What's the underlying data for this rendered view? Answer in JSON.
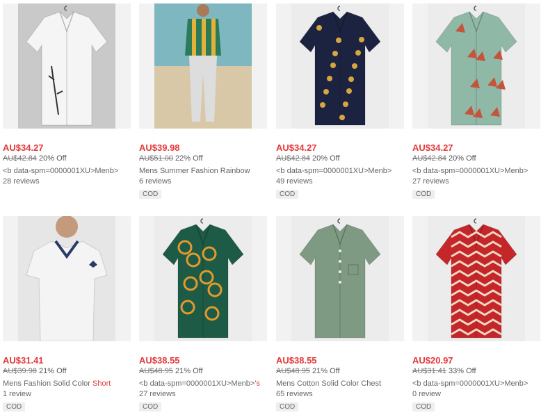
{
  "products": [
    {
      "price": "AU$34.27",
      "original_price": "AU$42.84",
      "discount": "20% Off",
      "title": "<b data-spm=0000001XU>Menb>",
      "title_highlight": "",
      "reviews": "28 reviews",
      "badge": ""
    },
    {
      "price": "AU$39.98",
      "original_price": "AU$51.00",
      "discount": "22% Off",
      "title": "Mens Summer Fashion Rainbow",
      "title_highlight": "",
      "reviews": "6 reviews",
      "badge": "COD"
    },
    {
      "price": "AU$34.27",
      "original_price": "AU$42.84",
      "discount": "20% Off",
      "title": "<b data-spm=0000001XU>Menb>",
      "title_highlight": "",
      "reviews": "49 reviews",
      "badge": "COD"
    },
    {
      "price": "AU$34.27",
      "original_price": "AU$42.84",
      "discount": "20% Off",
      "title": "<b data-spm=0000001XU>Menb>",
      "title_highlight": "",
      "reviews": "27 reviews",
      "badge": "COD"
    },
    {
      "price": "AU$31.41",
      "original_price": "AU$39.98",
      "discount": "21% Off",
      "title": "Mens Fashion Solid Color ",
      "title_highlight": "Short",
      "reviews": "1 review",
      "badge": "COD"
    },
    {
      "price": "AU$38.55",
      "original_price": "AU$48.95",
      "discount": "21% Off",
      "title": "<b data-spm=0000001XU>Menb>",
      "title_highlight": "'s",
      "reviews": "27 reviews",
      "badge": "COD"
    },
    {
      "price": "AU$38.55",
      "original_price": "AU$48.95",
      "discount": "21% Off",
      "title": "Mens Cotton Solid Color Chest",
      "title_highlight": "",
      "reviews": "65 reviews",
      "badge": "COD"
    },
    {
      "price": "AU$20.97",
      "original_price": "AU$31.41",
      "discount": "33% Off",
      "title": "<b data-spm=0000001XU>Menb>",
      "title_highlight": "",
      "reviews": "0 review",
      "badge": "COD"
    }
  ],
  "images": [
    {
      "name": "white-shirt-image",
      "bg": "#c9c9c9",
      "color": "#f5f5f5",
      "pattern": "bamboo"
    },
    {
      "name": "rainbow-stripe-shirt-model-image",
      "bg": "#d8cfc0",
      "color": "#dddddd",
      "pattern": "model"
    },
    {
      "name": "navy-sun-moon-shirt-image",
      "bg": "#ececec",
      "color": "#1b2340",
      "pattern": "stars"
    },
    {
      "name": "green-floral-shirt-image",
      "bg": "#ececec",
      "color": "#8fb9a6",
      "pattern": "leaves"
    },
    {
      "name": "white-polo-model-image",
      "bg": "#e6e6e6",
      "color": "#f4f4f4",
      "pattern": "polo"
    },
    {
      "name": "green-orange-print-shirt-image",
      "bg": "#ececec",
      "color": "#1d5b47",
      "pattern": "circles"
    },
    {
      "name": "sage-green-henley-shirt-image",
      "bg": "#ececec",
      "color": "#7f9a82",
      "pattern": "plain"
    },
    {
      "name": "red-chevron-shirt-image",
      "bg": "#ececec",
      "color": "#c4262a",
      "pattern": "chevron"
    }
  ]
}
